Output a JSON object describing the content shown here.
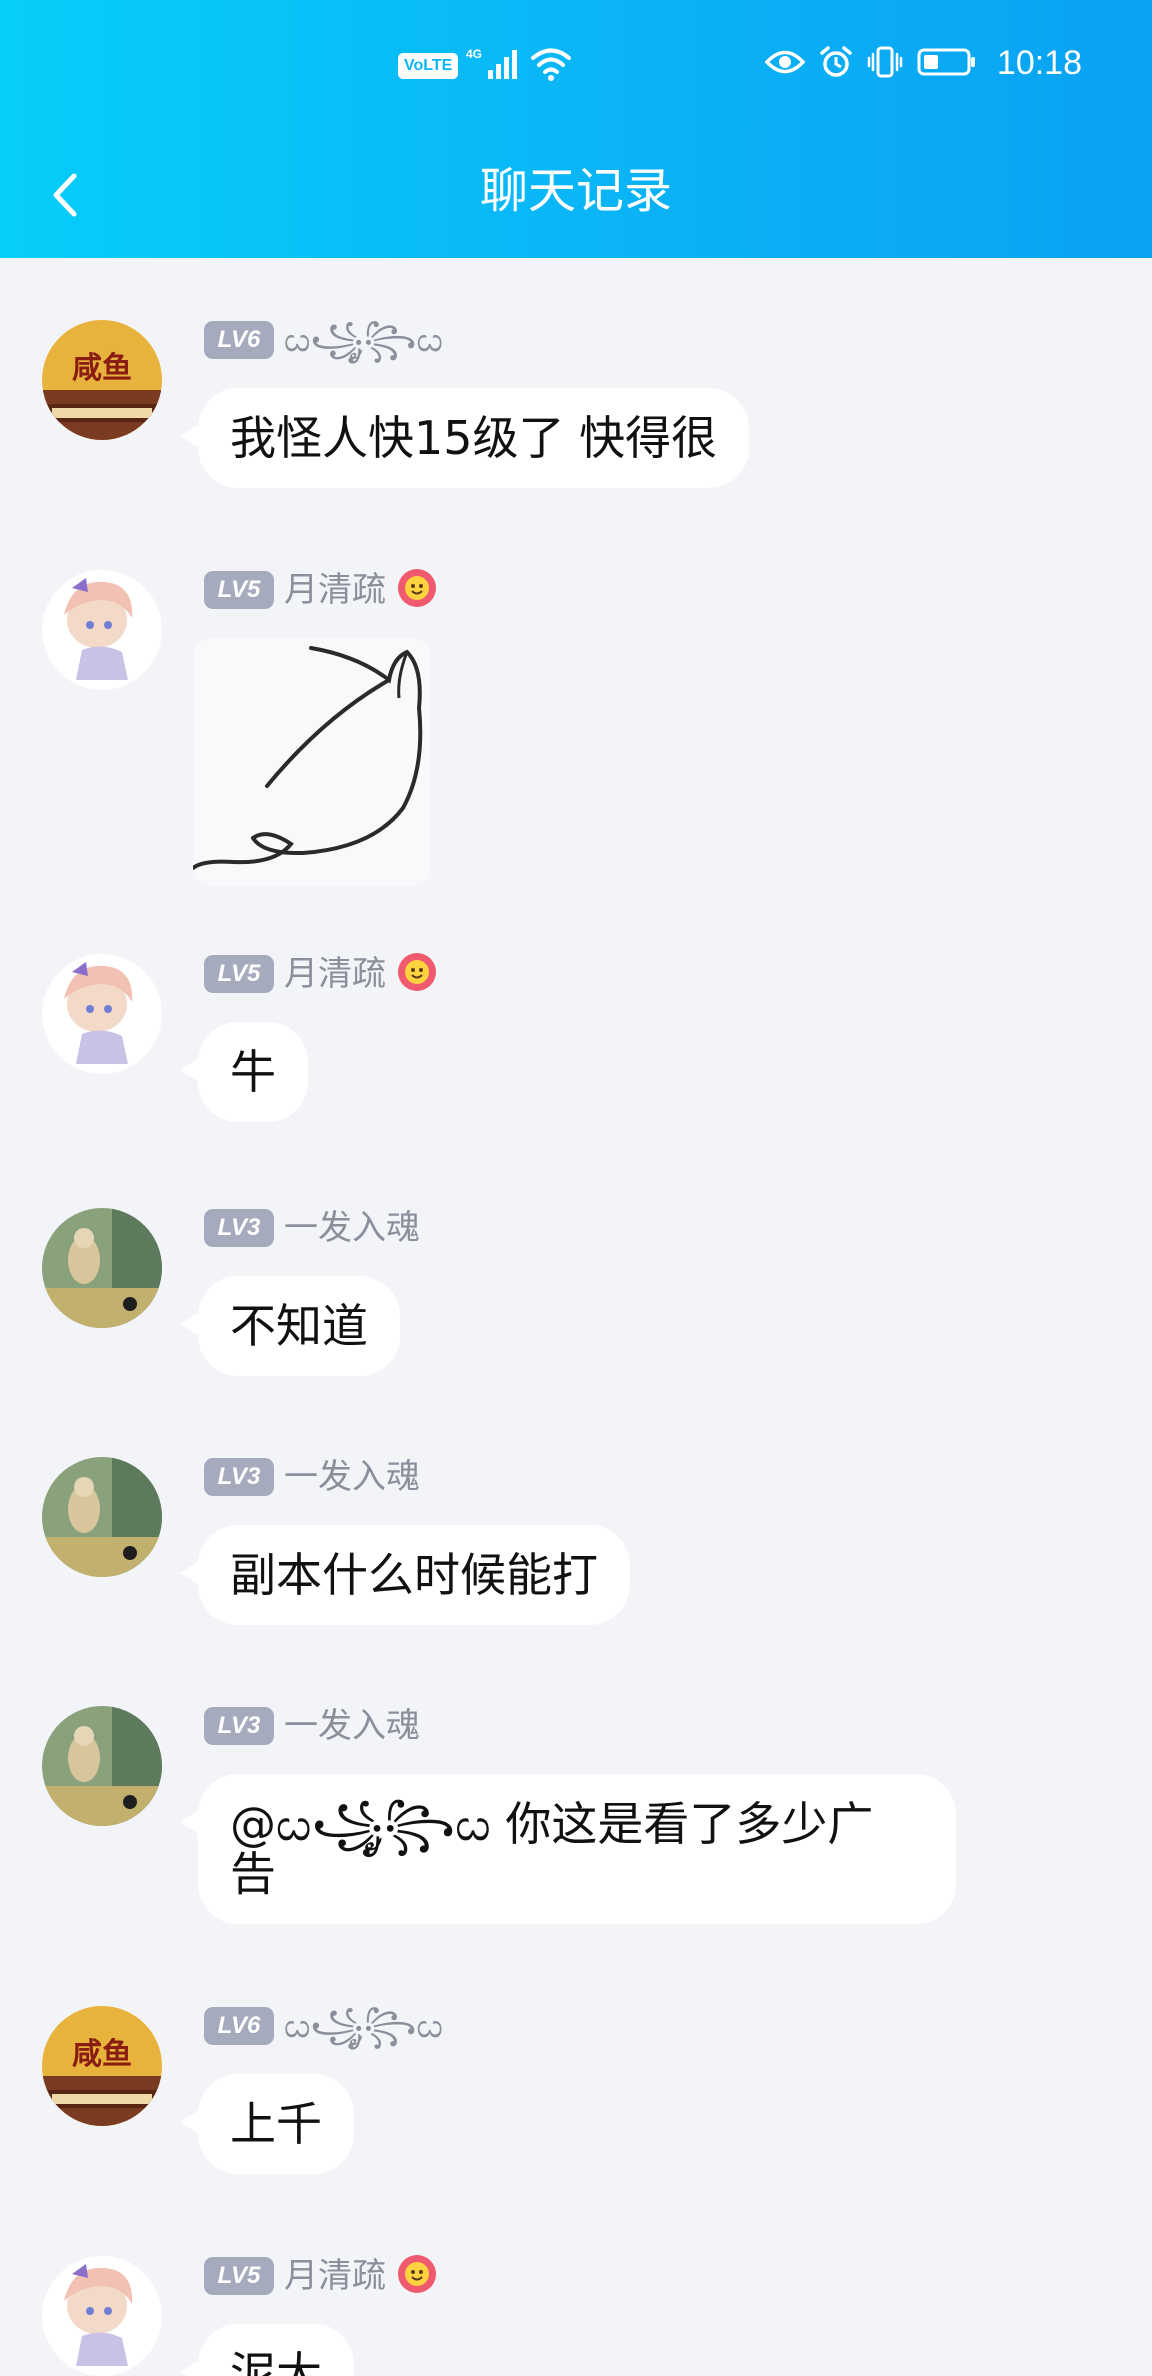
{
  "status_bar": {
    "volte": "VoLTE",
    "network": "4G",
    "time": "10:18"
  },
  "header": {
    "title": "聊天记录",
    "back_icon": "chevron-left-icon"
  },
  "messages": [
    {
      "level": "LV6",
      "nick": "ᦍ꧁ᤢ꧂ᦍ",
      "text": "我怪人快15级了 快得很",
      "avatar": "game-logo-avatar"
    },
    {
      "level": "LV5",
      "nick": "月清疏",
      "badge": "flower-emoji-icon",
      "image": "sticker-image",
      "avatar": "anime-girl-avatar"
    },
    {
      "level": "LV5",
      "nick": "月清疏",
      "badge": "flower-emoji-icon",
      "text": "牛",
      "avatar": "anime-girl-avatar"
    },
    {
      "level": "LV3",
      "nick": "一发入魂",
      "text": "不知道",
      "avatar": "street-photo-avatar"
    },
    {
      "level": "LV3",
      "nick": "一发入魂",
      "text": "副本什么时候能打",
      "avatar": "street-photo-avatar"
    },
    {
      "level": "LV3",
      "nick": "一发入魂",
      "text": "@ᦍ꧁ᤢ꧂ᦍ 你这是看了多少广\n告",
      "avatar": "street-photo-avatar"
    },
    {
      "level": "LV6",
      "nick": "ᦍ꧁ᤢ꧂ᦍ",
      "text": "上千",
      "avatar": "game-logo-avatar"
    },
    {
      "level": "LV5",
      "nick": "月清疏",
      "badge": "flower-emoji-icon",
      "text": "泥大",
      "avatar": "anime-girl-avatar"
    }
  ]
}
